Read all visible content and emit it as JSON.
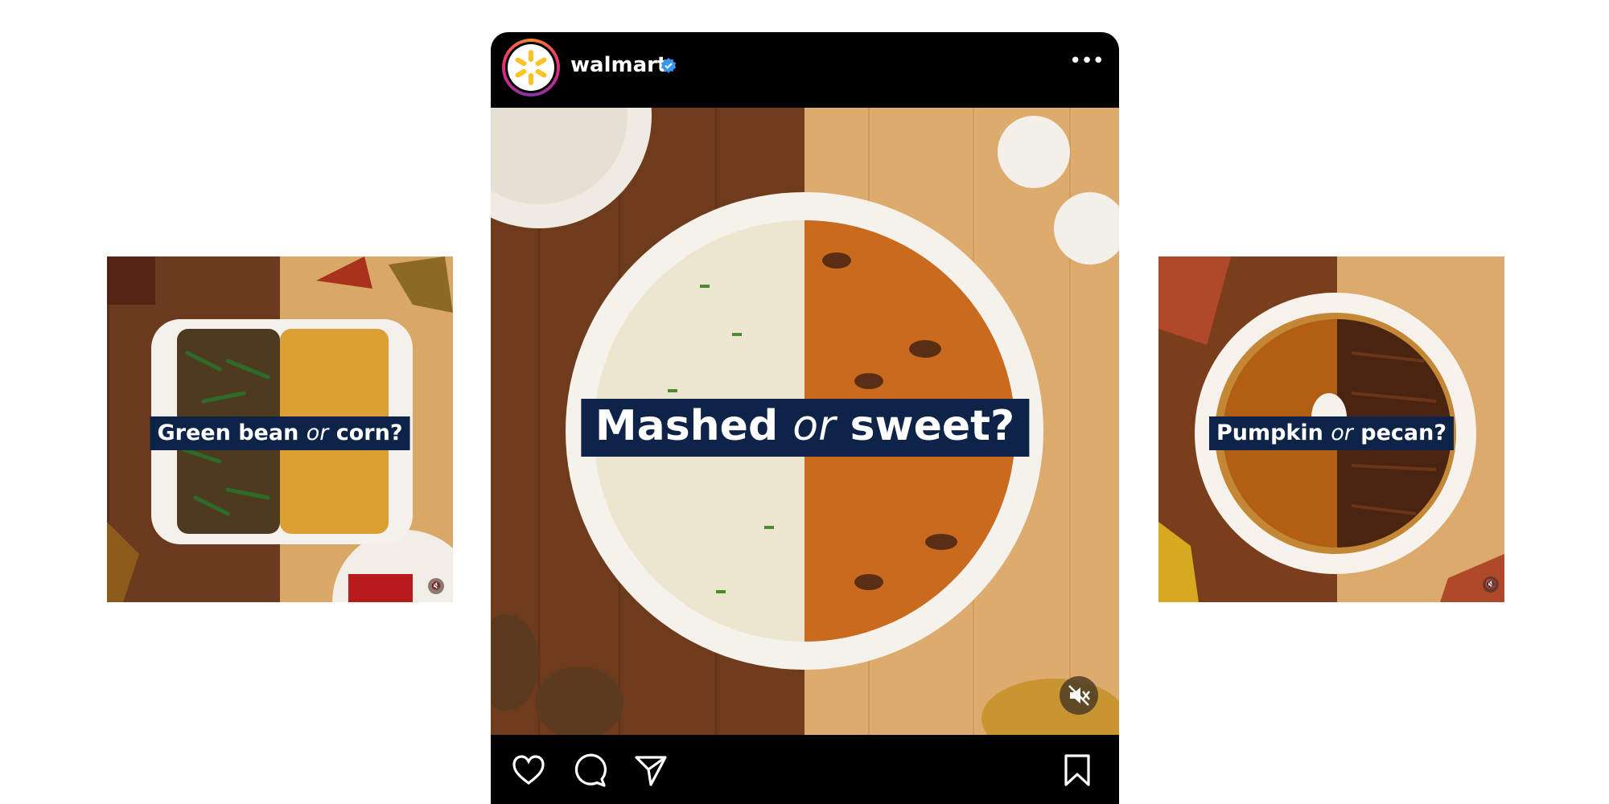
{
  "left_card": {
    "caption": {
      "part1": "Green bean ",
      "or": "or",
      "part2": " corn?"
    },
    "icon": "muted-speaker-icon"
  },
  "right_card": {
    "caption": {
      "part1": "Pumpkin ",
      "or": "or",
      "part2": " pecan?"
    },
    "icon": "muted-speaker-icon"
  },
  "post": {
    "username": "walmart",
    "verified": true,
    "more_icon": "•••",
    "caption": {
      "part1": "Mashed ",
      "or": "or",
      "part2": " sweet?"
    },
    "mute_icon": "muted-speaker-icon",
    "actions": [
      "heart-icon",
      "comment-icon",
      "share-icon",
      "bookmark-icon"
    ]
  },
  "colors": {
    "caption_bg": "#0e2348",
    "walmart_spark": "#ffc220",
    "verified_blue": "#3797f0"
  }
}
